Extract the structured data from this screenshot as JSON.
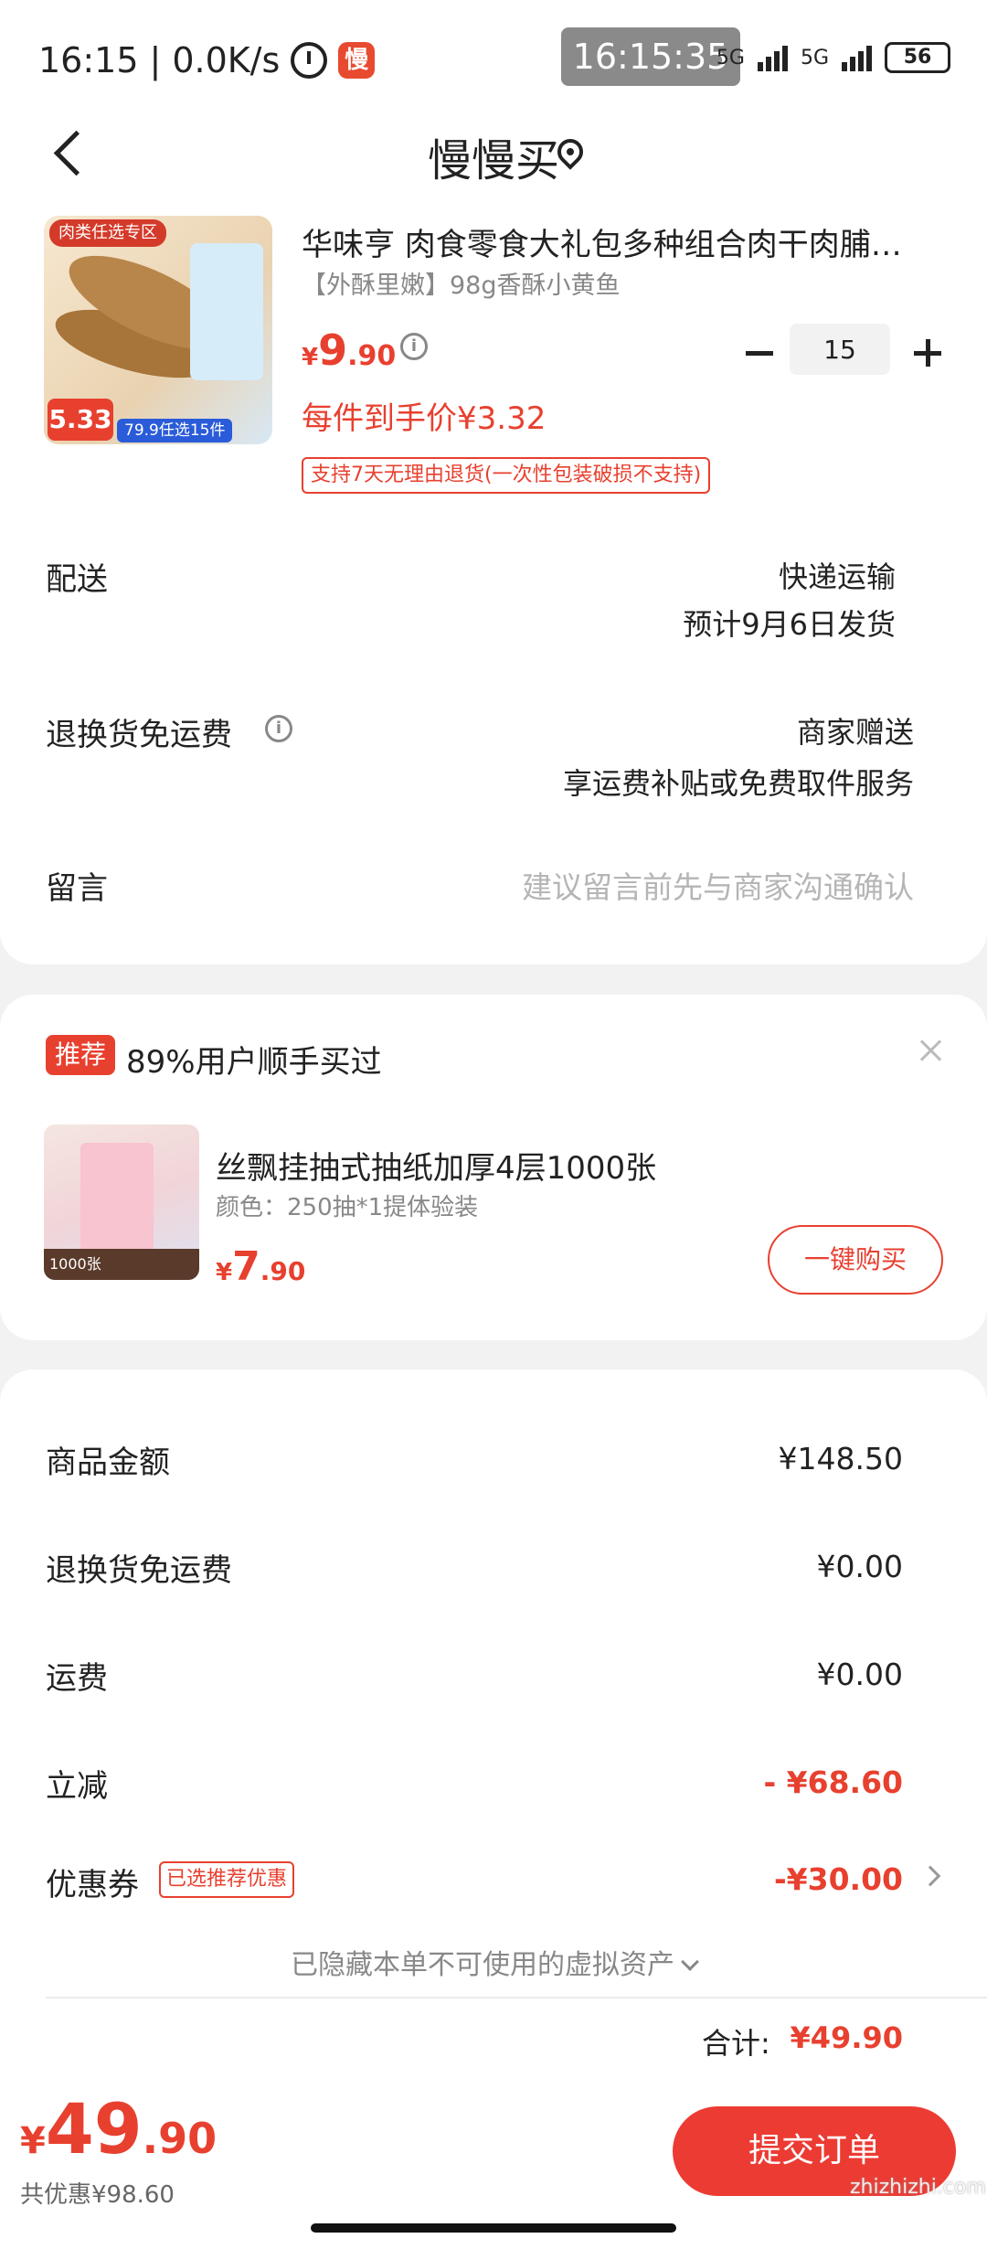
{
  "status_bar": {
    "time": "16:15",
    "speed": "0.0K/s",
    "app_icon": "慢",
    "overlay_time": "16:15:35",
    "net1": "5G",
    "net2": "5G",
    "battery": "56"
  },
  "header": {
    "title": "慢慢买"
  },
  "product": {
    "image_tag": "肉类任选专区",
    "image_price": "5.33",
    "image_promo": "79.9任选15件",
    "title": "华味亨 肉食零食大礼包多种组合肉干肉脯…",
    "spec": "【外酥里嫩】98g香酥小黄鱼",
    "price_currency": "¥",
    "price_int": "9",
    "price_dec": ".90",
    "quantity": "15",
    "unit_price": "每件到手价¥3.32",
    "return_tag": "支持7天无理由退货(一次性包装破损不支持)"
  },
  "delivery": {
    "label": "配送",
    "method": "快递运输",
    "eta": "预计9月6日发货"
  },
  "return_shipping": {
    "label": "退换货免运费",
    "value": "商家赠送",
    "detail": "享运费补贴或免费取件服务"
  },
  "message": {
    "label": "留言",
    "placeholder": "建议留言前先与商家沟通确认"
  },
  "recommend": {
    "badge": "推荐",
    "title": "89%用户顺手买过",
    "image_strip": "1000张",
    "name": "丝飘挂抽式抽纸加厚4层1000张",
    "spec": "颜色：250抽*1提体验装",
    "price_currency": "¥",
    "price_int": "7",
    "price_dec": ".90",
    "buy_label": "一键购买"
  },
  "summary": {
    "goods_label": "商品金额",
    "goods_value": "¥148.50",
    "return_label": "退换货免运费",
    "return_value": "¥0.00",
    "shipping_label": "运费",
    "shipping_value": "¥0.00",
    "discount_label": "立减",
    "discount_value": "- ¥68.60",
    "coupon_label": "优惠券",
    "coupon_tag": "已选推荐优惠",
    "coupon_value": "-¥30.00",
    "hidden_note": "已隐藏本单不可使用的虚拟资产",
    "total_label": "合计:",
    "total_value": "¥49.90"
  },
  "bottom_bar": {
    "price_currency": "¥",
    "price_int": "49",
    "price_dec": ".90",
    "saving": "共优惠¥98.60",
    "submit_label": "提交订单"
  },
  "watermark": "zhizhizhi.com",
  "colors": {
    "accent": "#e8402f",
    "button": "#ec3b33",
    "muted": "#888888"
  }
}
